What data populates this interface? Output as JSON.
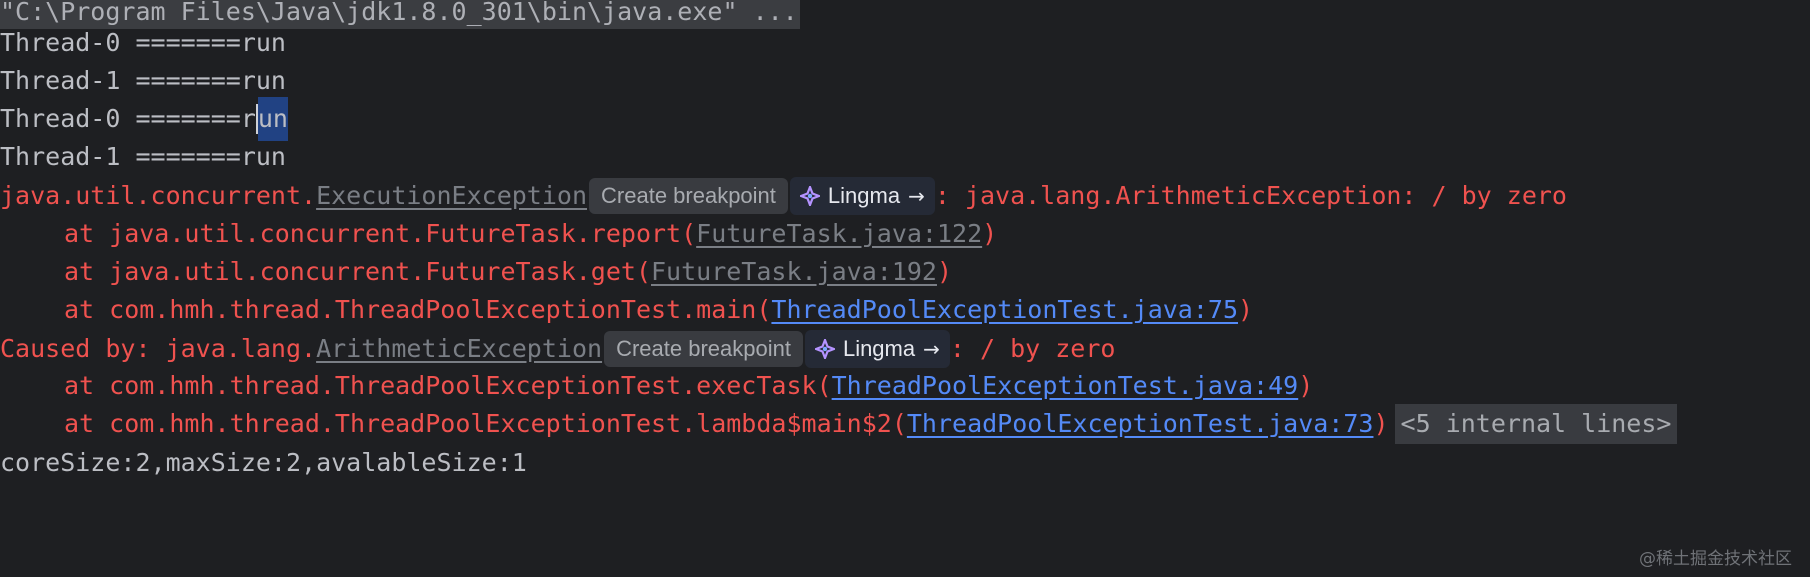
{
  "console": {
    "command": "\"C:\\Program Files\\Java\\jdk1.8.0_301\\bin\\java.exe\" ...",
    "thread_lines": [
      "Thread-0 =======run",
      "Thread-1 =======run"
    ],
    "thread_line_3_prefix": "Thread-0 =======r",
    "thread_line_3_selected": "un",
    "thread_line_4": "Thread-1 =======run",
    "exception": {
      "prefix": "java.util.concurrent.",
      "class_link": "ExecutionException",
      "suffix": ": java.lang.ArithmeticException: / by zero"
    },
    "stack_1": [
      {
        "text": "at java.util.concurrent.FutureTask.report(",
        "link": "FutureTask.java:122",
        "close": ")",
        "link_style": "grey"
      },
      {
        "text": "at java.util.concurrent.FutureTask.get(",
        "link": "FutureTask.java:192",
        "close": ")",
        "link_style": "grey"
      },
      {
        "text": "at com.hmh.thread.ThreadPoolExceptionTest.main(",
        "link": "ThreadPoolExceptionTest.java:75",
        "close": ")",
        "link_style": "blue"
      }
    ],
    "caused_by": {
      "prefix": "Caused by: java.lang.",
      "class_link": "ArithmeticException",
      "suffix": ": / by zero"
    },
    "stack_2": [
      {
        "text": "at com.hmh.thread.ThreadPoolExceptionTest.execTask(",
        "link": "ThreadPoolExceptionTest.java:49",
        "close": ")"
      },
      {
        "text": "at com.hmh.thread.ThreadPoolExceptionTest.lambda$main$2(",
        "link": "ThreadPoolExceptionTest.java:73",
        "close": ")",
        "folded": "<5 internal lines>"
      }
    ],
    "last_line": "coreSize:2,maxSize:2,avalableSize:1"
  },
  "hints": {
    "create_breakpoint": "Create breakpoint",
    "lingma": "Lingma",
    "arrow": "→"
  },
  "watermark": "@稀土掘金技术社区",
  "colors": {
    "background": "#1e1f22",
    "error_text": "#f0524f",
    "link": "#548af7",
    "normal_text": "#bcbec4"
  }
}
